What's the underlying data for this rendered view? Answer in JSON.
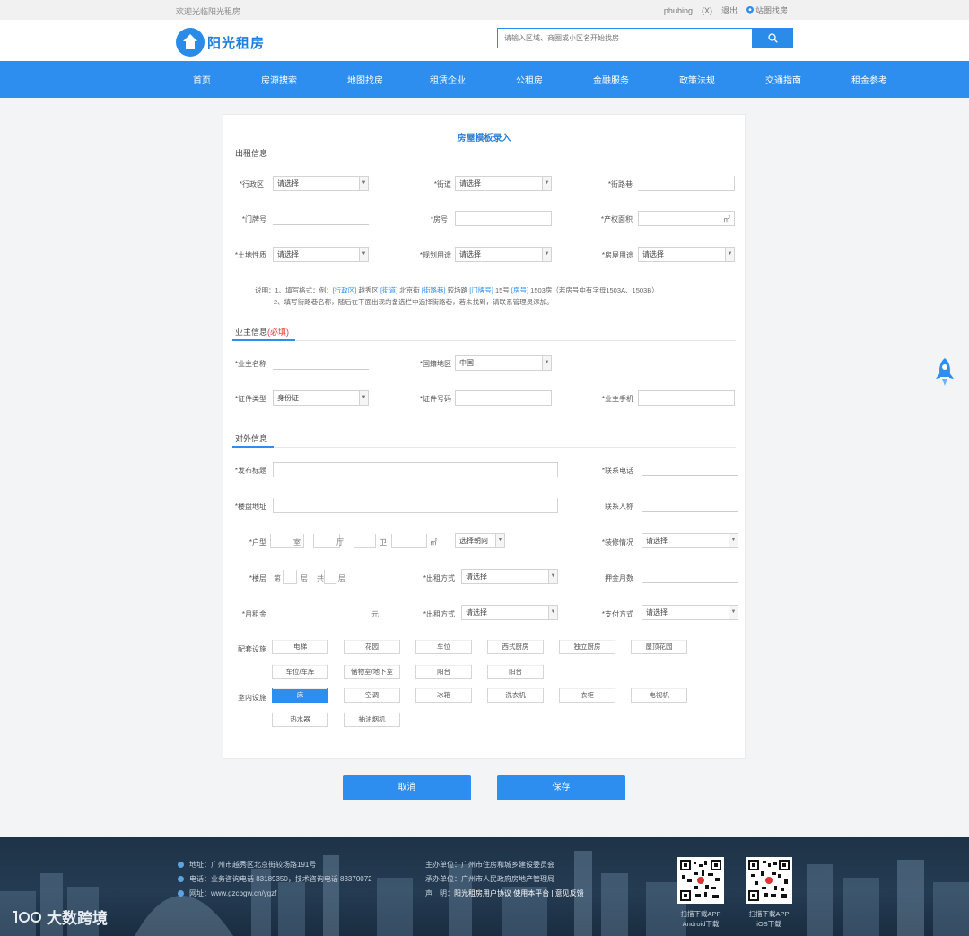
{
  "topbar": {
    "welcome": "欢迎光临阳光租房",
    "user": "phubing",
    "tag": "(X)",
    "logout": "退出",
    "map": "站图找房"
  },
  "header": {
    "logo_text": "阳光租房",
    "search_placeholder": "请输入区域、商圈或小区名开始找房"
  },
  "nav": [
    "首页",
    "房源搜索",
    "地图找房",
    "租赁企业",
    "公租房",
    "金融服务",
    "政策法规",
    "交通指南",
    "租金参考"
  ],
  "form": {
    "title": "房屋模板录入",
    "sections": {
      "property": "出租信息",
      "owner": "业主信息",
      "owner_suffix": "(必填)",
      "public": "对外信息"
    },
    "property": {
      "district_label": "*行政区",
      "district_value": "请选择",
      "street_label": "*街道",
      "street_value": "请选择",
      "road_label": "*街路巷",
      "door_label": "*门牌号",
      "room_label": "*房号",
      "area_label": "*产权面积",
      "area_unit": "㎡",
      "land_label": "*土地性质",
      "land_value": "请选择",
      "use_label": "*规划用途",
      "use_value": "请选择",
      "house_use_label": "*房屋用途",
      "house_use_value": "请选择"
    },
    "note": {
      "line1_a": "说明：1、填写格式：例：",
      "line1_b": "[行政区]",
      "line1_c": " 越秀区 ",
      "line1_d": "[街道]",
      "line1_e": " 北京街 ",
      "line1_f": "[街路巷]",
      "line1_g": " 较场路 ",
      "line1_h": "[门牌号]",
      "line1_i": " 15号 ",
      "line1_j": "[房号]",
      "line1_k": " 1503房（若房号中有字母1503A、1503B）",
      "line2": "2、填写街路巷名称，随后在下面出现的备选栏中选择街路巷，若未找到，请联系管理员添加。"
    },
    "owner": {
      "name_label": "*业主名称",
      "country_label": "*国籍地区",
      "country_value": "中国",
      "id_type_label": "*证件类型",
      "id_type_value": "身份证",
      "id_no_label": "*证件号码",
      "phone_label": "*业主手机"
    },
    "public": {
      "title_label": "*发布标题",
      "contact_phone_label": "*联系电话",
      "address_label": "*楼盘地址",
      "contact_name_label": "联系人称",
      "layout_label": "*户型",
      "room_unit": "室",
      "hall_unit": "厅",
      "bath_unit": "卫",
      "size_unit": "㎡",
      "orientation_value": "选择朝向",
      "decor_label": "*装修情况",
      "decor_value": "请选择",
      "floor_label": "*楼层",
      "floor_a": "第",
      "floor_b": "层",
      "floor_c": "共",
      "floor_d": "层",
      "rent_type_label": "*出租方式",
      "rent_type_value": "请选择",
      "deposit_label": "押金月数",
      "rent_label": "*月租金",
      "rent_unit": "元",
      "rent_method_label": "*出租方式",
      "rent_method_value": "请选择",
      "pay_label": "*支付方式",
      "pay_value": "请选择",
      "facility_label": "配套设施",
      "facilities": [
        "电梯",
        "花园",
        "车位",
        "西式厨房",
        "独立厨房",
        "屋顶花园",
        "车位/车库",
        "储物室/地下室",
        "阳台",
        "阳台"
      ],
      "appliance_label": "室内设施",
      "appliances": [
        "床",
        "空调",
        "冰箱",
        "洗衣机",
        "衣柜",
        "电视机",
        "热水器",
        "抽油烟机"
      ]
    }
  },
  "buttons": {
    "cancel": "取消",
    "save": "保存"
  },
  "footer": {
    "address": "地址：广州市越秀区北京街较场路191号",
    "phone": "电话：业务咨询电话 83189350，技术咨询电话 83370072",
    "site": "网址：www.gzcbgw.cn/ygzf",
    "host": "主办单位：广州市住房和城乡建设委员会",
    "undertake": "承办单位：广州市人民政府房地产管理局",
    "statement_a": "声　明：",
    "statement_b": "阳光租房用户协议  使用本平台 | 意见反馈",
    "android": "扫描下载APP\nAndroid下载",
    "ios": "扫描下载APP\niOS下载"
  },
  "watermark": "大数跨境"
}
